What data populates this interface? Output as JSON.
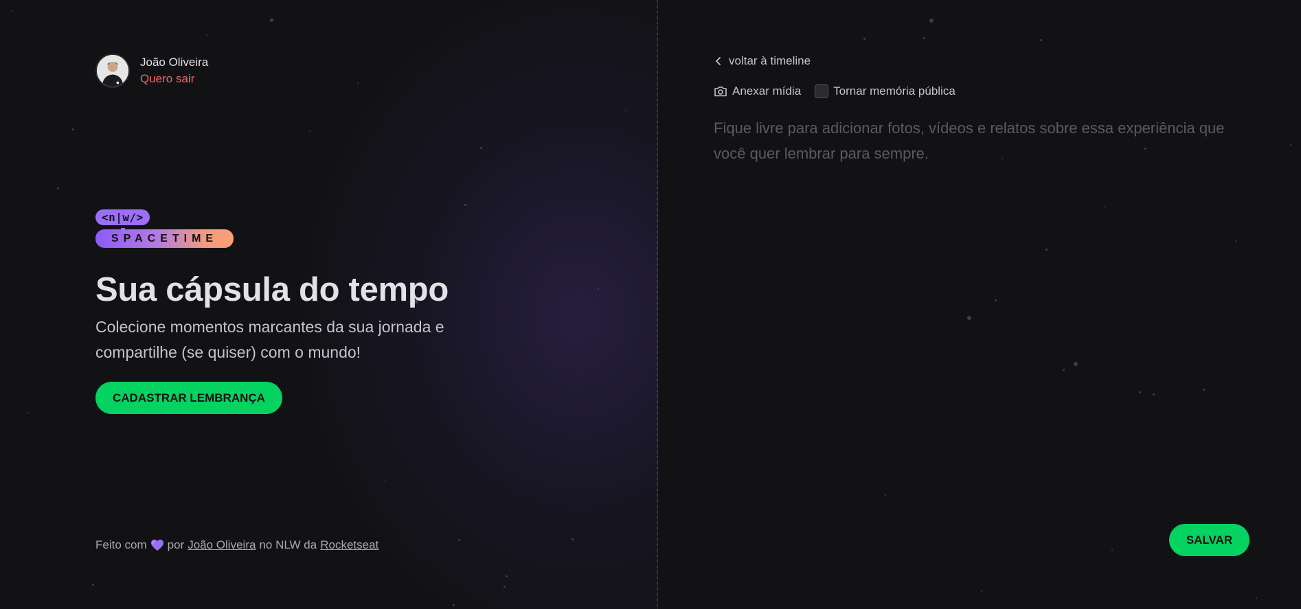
{
  "user": {
    "name": "João Oliveira",
    "logout_label": "Quero sair"
  },
  "logo": {
    "badge_text": "<n|w/>",
    "wordmark": "SPACETIME"
  },
  "hero": {
    "title": "Sua cápsula do tempo",
    "subtitle": "Colecione momentos marcantes da sua jornada e compartilhe (se quiser) com o mundo!",
    "cta_label": "CADASTRAR LEMBRANÇA"
  },
  "footer": {
    "prefix": "Feito com",
    "by": "por",
    "author": "João Oliveira",
    "middle": "no NLW da",
    "company": "Rocketseat",
    "heart_icon": "purple-heart-icon"
  },
  "form": {
    "back_label": "voltar à timeline",
    "attach_label": "Anexar mídia",
    "public_label": "Tornar memória pública",
    "public_checked": false,
    "content_placeholder": "Fique livre para adicionar fotos, vídeos e relatos sobre essa experiência que você quer lembrar para sempre.",
    "content_value": "",
    "save_label": "SALVAR"
  },
  "colors": {
    "background": "#121215",
    "accent_green": "#04d361",
    "logout_red": "#f36566",
    "brand_purple": "#9b6ff7",
    "brand_orange": "#f9a07a"
  }
}
